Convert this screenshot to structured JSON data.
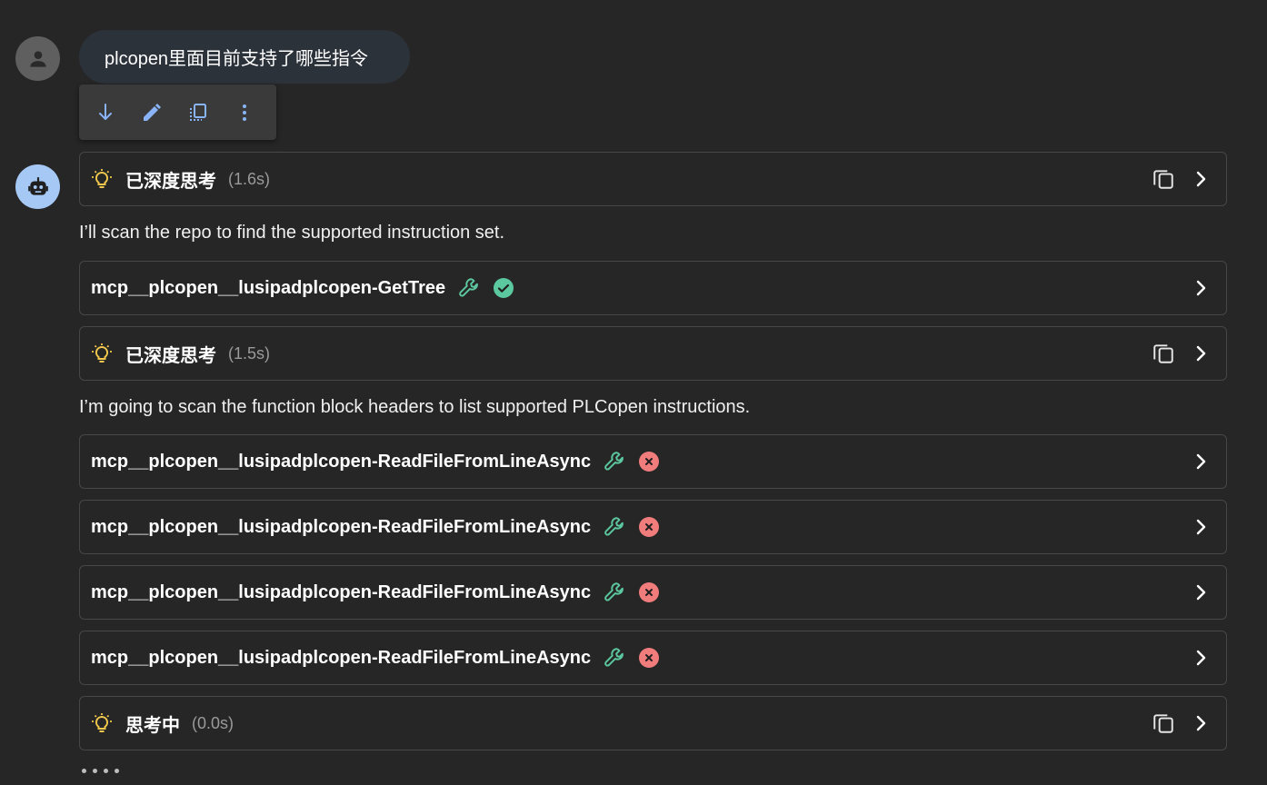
{
  "user_message": "plcopen里面目前支持了哪些指令",
  "message_toolbar": {
    "icons": [
      "arrow-down-icon",
      "edit-icon",
      "copy-icon",
      "more-vert-icon"
    ],
    "icon_color": "#8ab4f8"
  },
  "blocks": [
    {
      "type": "thinking",
      "title": "已深度思考",
      "time": "(1.6s)"
    },
    {
      "type": "message",
      "text": "I’ll scan the repo to find the supported instruction set."
    },
    {
      "type": "tool",
      "title": "mcp__plcopen__lusipadplcopen-GetTree",
      "status": "success"
    },
    {
      "type": "thinking",
      "title": "已深度思考",
      "time": "(1.5s)"
    },
    {
      "type": "message",
      "text": "I’m going to scan the function block headers to list supported PLCopen instructions."
    },
    {
      "type": "tool",
      "title": "mcp__plcopen__lusipadplcopen-ReadFileFromLineAsync",
      "status": "error"
    },
    {
      "type": "tool",
      "title": "mcp__plcopen__lusipadplcopen-ReadFileFromLineAsync",
      "status": "error"
    },
    {
      "type": "tool",
      "title": "mcp__plcopen__lusipadplcopen-ReadFileFromLineAsync",
      "status": "error"
    },
    {
      "type": "tool",
      "title": "mcp__plcopen__lusipadplcopen-ReadFileFromLineAsync",
      "status": "error"
    },
    {
      "type": "thinking",
      "title": "思考中",
      "time": "(0.0s)"
    }
  ],
  "colors": {
    "background": "#262626",
    "bulb": "#f2c94c",
    "tool_wrench": "#5cc8a0",
    "success": "#5cc8a0",
    "error": "#f07c7c"
  }
}
